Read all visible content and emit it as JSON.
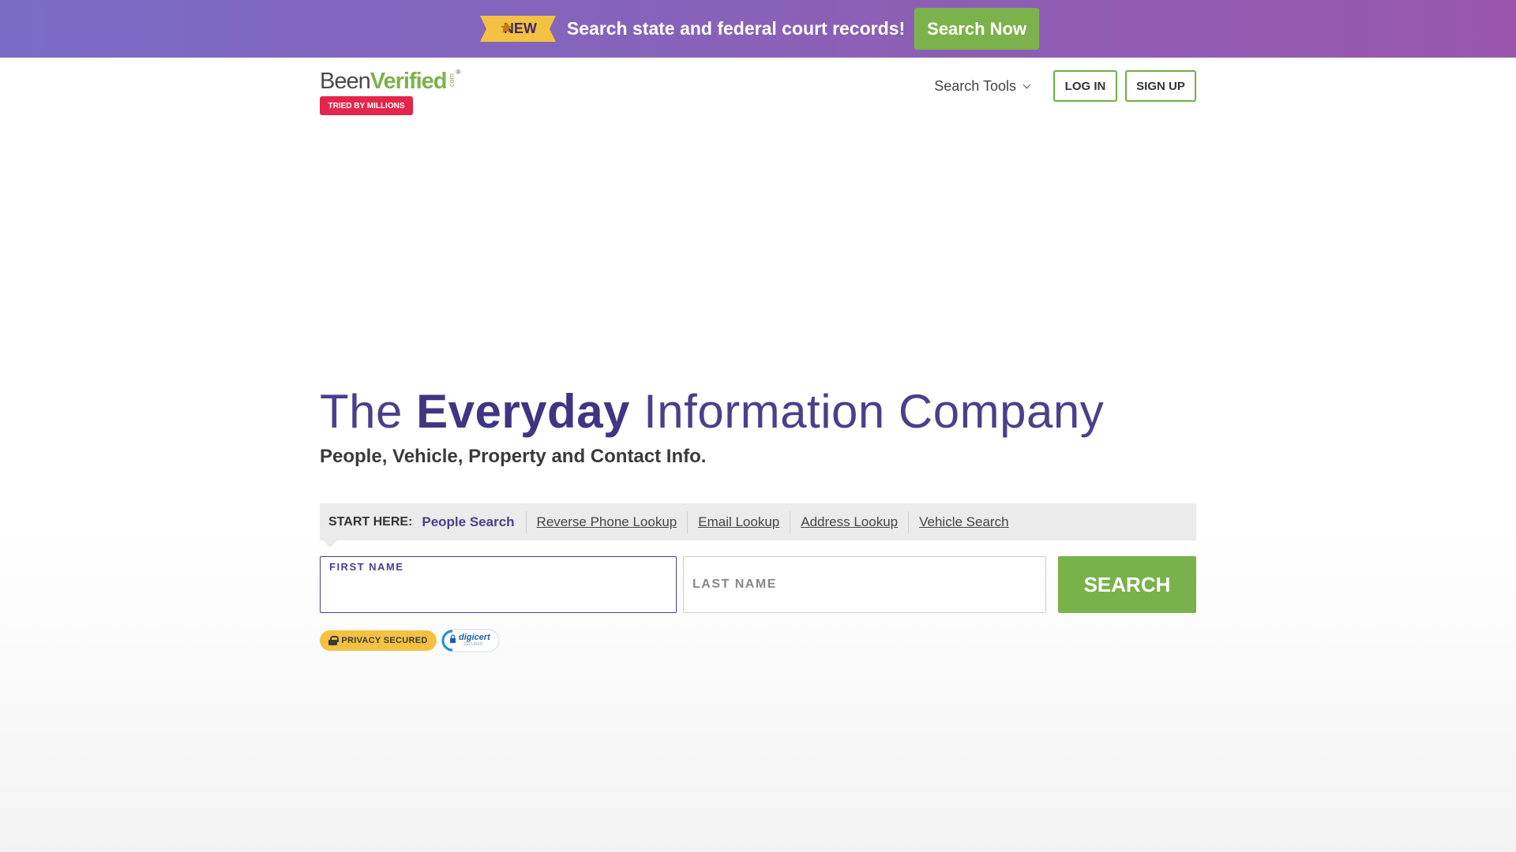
{
  "promo": {
    "badge": "NEW",
    "text": "Search state and federal court records!",
    "button": "Search Now",
    "icon": "star-icon"
  },
  "header": {
    "logo": {
      "been": "Been",
      "verified": "Verified",
      "dotcom": ".com",
      "reg": "®"
    },
    "badge": "TRIED BY MILLIONS",
    "search_tools": "Search Tools",
    "login": "LOG IN",
    "signup": "SIGN UP"
  },
  "hero": {
    "title_pre": "The",
    "title_strong": "Everyday",
    "title_post": "Information Company",
    "subtitle": "People, Vehicle, Property and Contact Info."
  },
  "tabs": {
    "start_label": "START HERE:",
    "items": [
      {
        "label": "People Search",
        "active": true
      },
      {
        "label": "Reverse Phone Lookup",
        "active": false
      },
      {
        "label": "Email Lookup",
        "active": false
      },
      {
        "label": "Address Lookup",
        "active": false
      },
      {
        "label": "Vehicle Search",
        "active": false
      }
    ]
  },
  "form": {
    "first_name_label": "FIRST NAME",
    "first_name_value": "",
    "last_name_label": "LAST NAME",
    "last_name_value": "",
    "search_button": "SEARCH"
  },
  "trust": {
    "privacy": "PRIVACY SECURED",
    "digicert": "digicert",
    "digicert_sub": "SECURED"
  },
  "colors": {
    "brand_purple": "#4b3f8c",
    "brand_green": "#79b24b",
    "promo_gradient_start": "#7a6cc6",
    "promo_gradient_end": "#9a56ad",
    "badge_red": "#e3264b",
    "privacy_yellow": "#f4c142"
  }
}
